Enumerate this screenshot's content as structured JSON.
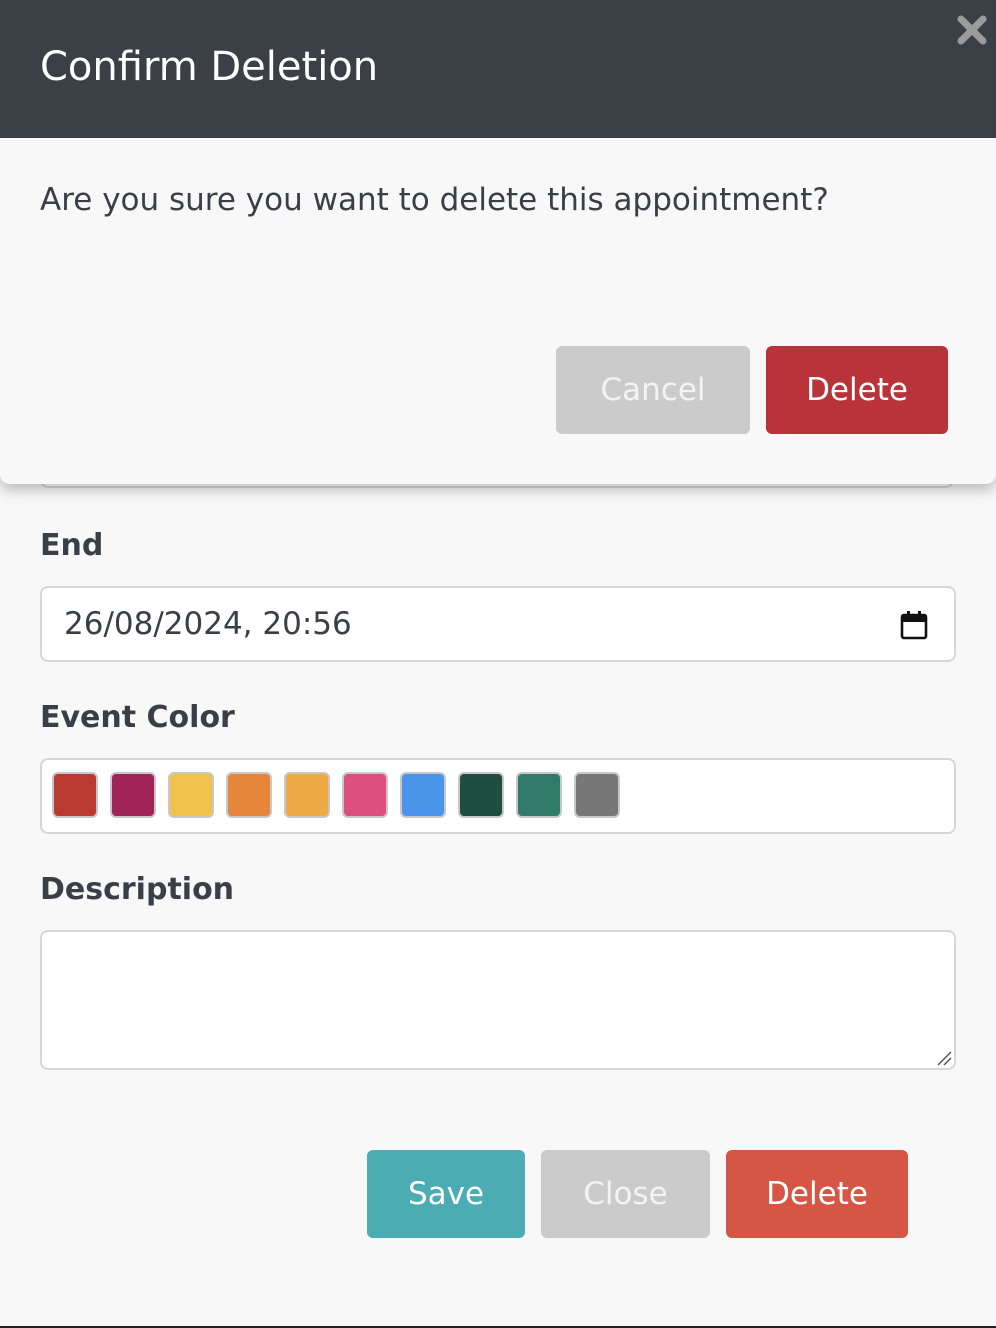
{
  "dialog": {
    "title": "Confirm Deletion",
    "message": "Are you sure you want to delete this appointment?",
    "cancel_label": "Cancel",
    "delete_label": "Delete",
    "close_icon": "close-icon"
  },
  "form": {
    "end_label": "End",
    "end_value": "26/08/2024, 20:56",
    "calendar_icon": "calendar-icon",
    "color_label": "Event Color",
    "colors": [
      "#b83a31",
      "#a0245a",
      "#f0c24c",
      "#e5863a",
      "#eeab45",
      "#dc5080",
      "#4a94ea",
      "#1f4d41",
      "#327a6a",
      "#777777"
    ],
    "description_label": "Description",
    "description_value": "",
    "save_label": "Save",
    "close_label": "Close",
    "delete_label": "Delete"
  },
  "colors": {
    "header_bg": "#3b3f46",
    "save": "#4cacb4",
    "neutral": "#cbcbcb",
    "danger_dialog": "#b8333a",
    "danger_form": "#d65646"
  }
}
